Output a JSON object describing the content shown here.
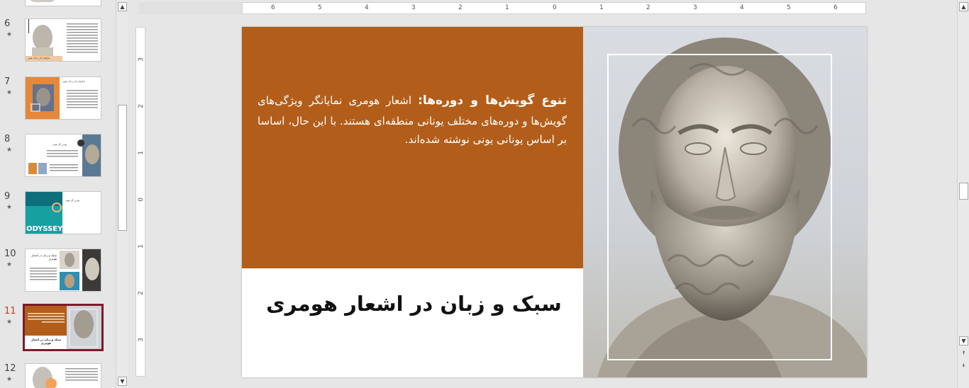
{
  "thumbnails": [
    {
      "number": "6",
      "star": "★",
      "caption": "سال‌های آخر زندگی هومر"
    },
    {
      "number": "7",
      "star": "★",
      "caption": "سال‌های آخر زندگی هومر"
    },
    {
      "number": "8",
      "star": "★",
      "caption": "بهترین آثار هومر"
    },
    {
      "number": "9",
      "star": "★",
      "caption": "بهترین آثار هومر",
      "cover": "ODYSSEY"
    },
    {
      "number": "10",
      "star": "★",
      "caption": "سبک و زبان در اشعار هومری"
    },
    {
      "number": "11",
      "star": "★",
      "caption": "سبک و زبان در اشعار هومری"
    },
    {
      "number": "12",
      "star": "★"
    }
  ],
  "ruler": {
    "horizontal": [
      "6",
      "5",
      "4",
      "3",
      "2",
      "1",
      "0",
      "1",
      "2",
      "3",
      "4",
      "5",
      "6"
    ],
    "vertical": [
      "3",
      "2",
      "1",
      "0",
      "1",
      "2",
      "3"
    ]
  },
  "slide": {
    "body_heading": "تنوع گویش‌ها و دوره‌ها:",
    "body_text": " اشعار هومری نمایانگر ویژگی‌های گویش‌ها و دوره‌های مختلف یونانی منطقه‌ای هستند. با این حال، اساسا بر اساس یونانی یونی نوشته شده‌اند.",
    "title": "سبک و زبان در اشعار هومری",
    "colors": {
      "accent": "#b25e1a",
      "selection": "#7b1c2a",
      "active_number": "#c43e1c"
    }
  },
  "icons": {
    "scroll_up": "▲",
    "scroll_down": "▼",
    "prev_slide": "⯭",
    "next_slide": "⯯"
  }
}
